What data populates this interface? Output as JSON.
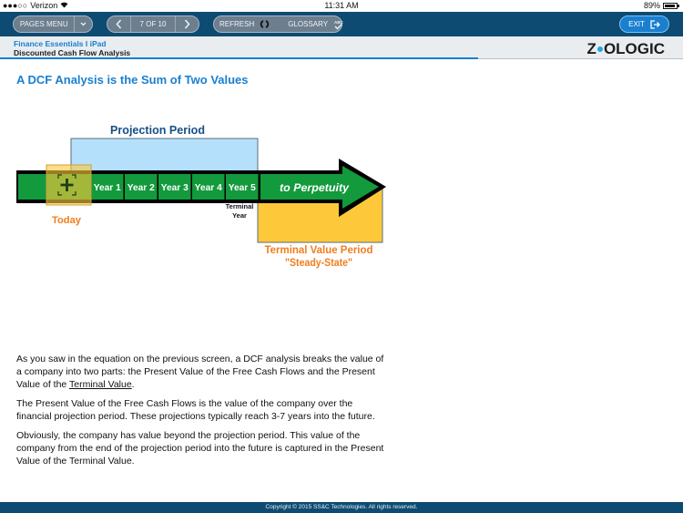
{
  "status_bar": {
    "signal": "●●●○○",
    "carrier": "Verizon",
    "time": "11:31 AM",
    "battery_percent": "89%",
    "battery_level": 0.89
  },
  "toolbar": {
    "pages_menu_label": "PAGES MENU",
    "pages_menu_dropdown_icon": "chevron-down-icon",
    "prev_icon": "chevron-left-icon",
    "page_indicator": "7 OF 10",
    "next_icon": "chevron-right-icon",
    "refresh_label": "REFRESH",
    "refresh_icon": "refresh-icon",
    "glossary_label": "GLOSSARY",
    "glossary_icon": "spellcheck-icon",
    "exit_label": "EXIT",
    "exit_icon": "exit-icon"
  },
  "course_header": {
    "course_title": "Finance Essentials I iPad",
    "module_title": "Discounted Cash Flow Analysis",
    "progress": 0.7,
    "logo_left": "Z",
    "logo_right": "OLOGIC"
  },
  "page": {
    "title": "A DCF Analysis is the Sum of Two Values"
  },
  "diagram": {
    "projection_label": "Projection Period",
    "today_label": "Today",
    "years": [
      "Year 1",
      "Year 2",
      "Year 3",
      "Year 4",
      "Year 5"
    ],
    "terminal_year_line1": "Terminal",
    "terminal_year_line2": "Year",
    "perpetuity_label": "to Perpetuity",
    "terminal_period_line1": "Terminal Value Period",
    "terminal_period_line2": "\"Steady-State\"",
    "colors": {
      "green": "#139a3c",
      "projection_blue": "#b5e0fb",
      "terminal_yellow": "#fdc93a",
      "orange_text": "#f07d1e",
      "navy_text": "#174f86"
    }
  },
  "body": {
    "p1_before": "As you saw in the equation on the previous screen, a DCF analysis breaks the value of a company into two parts: the Present Value of the Free Cash Flows and the Present Value of the ",
    "p1_link": "Terminal Value",
    "p1_after": ".",
    "p2": "The Present Value of the Free Cash Flows is the value of the company over the financial projection period. These projections typically reach 3-7 years into the future.",
    "p3": "Obviously, the company has value beyond the projection period. This value of the company from the end of the projection period into the future is captured in the Present Value of the Terminal Value."
  },
  "footer": {
    "copyright": "Copyright © 2015 SS&C Technologies. All rights reserved."
  }
}
